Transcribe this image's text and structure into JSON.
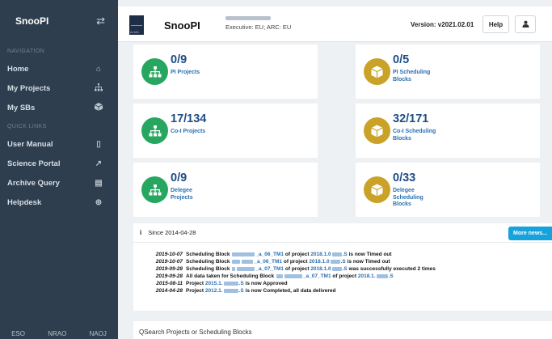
{
  "sidebar": {
    "title": "SnooPI",
    "swap_icon": "swap-icon",
    "sections": {
      "navigation": "NAVIGATION",
      "quick_links": "QUICK LINKS"
    },
    "nav_items": [
      {
        "label": "Home",
        "icon": "home-icon"
      },
      {
        "label": "My Projects",
        "icon": "sitemap-icon"
      },
      {
        "label": "My SBs",
        "icon": "cube-icon"
      }
    ],
    "quick_items": [
      {
        "label": "User Manual",
        "icon": "document-icon"
      },
      {
        "label": "Science Portal",
        "icon": "external-link-icon"
      },
      {
        "label": "Archive Query",
        "icon": "archive-icon"
      },
      {
        "label": "Helpdesk",
        "icon": "lifebuoy-icon"
      }
    ],
    "footer": [
      "ESO",
      "NRAO",
      "NAOJ"
    ]
  },
  "header": {
    "logo_text": "ALMA",
    "title": "SnooPI",
    "executive": "Executive: EU; ARC: EU",
    "version": "Version: v2021.02.01",
    "help_label": "Help",
    "user_icon": "user-icon"
  },
  "cards": [
    {
      "count": "0/9",
      "label": "PI Projects",
      "icon": "sitemap-icon",
      "color": "#27a65f"
    },
    {
      "count": "0/5",
      "label": "PI Scheduling Blocks",
      "icon": "cube-icon",
      "color": "#c9a227"
    },
    {
      "count": "17/134",
      "label": "Co-I Projects",
      "icon": "sitemap-icon",
      "color": "#27a65f"
    },
    {
      "count": "32/171",
      "label": "Co-I Scheduling Blocks",
      "icon": "cube-icon",
      "color": "#c9a227"
    },
    {
      "count": "0/9",
      "label": "Delegee Projects",
      "icon": "sitemap-icon",
      "color": "#27a65f"
    },
    {
      "count": "0/33",
      "label": "Delegee Scheduling Blocks",
      "icon": "cube-icon",
      "color": "#c9a227"
    }
  ],
  "news": {
    "since": "Since 2014-04-28",
    "more_label": "More news...",
    "rows": [
      {
        "date": "2019-10-07",
        "t1": "Scheduling Block",
        "sb": "_a_06_TM1",
        "t2": "of project",
        "proj": "2018.1.0",
        "proj_end": ".S",
        "t3": "is now Timed out"
      },
      {
        "date": "2019-10-07",
        "t1": "Scheduling Block",
        "sb": "_a_06_TM1",
        "t2": "of project",
        "proj": "2018.1.0",
        "proj_end": ".S",
        "t3": "is now Timed out"
      },
      {
        "date": "2019-09-28",
        "t1": "Scheduling Block",
        "sb": "_a_07_TM1",
        "t2": "of project",
        "proj": "2018.1.0",
        "proj_end": ".S",
        "t3": "was successfully executed 2 times"
      },
      {
        "date": "2019-09-28",
        "t1": "All data taken for Scheduling Block",
        "sb": "_a_07_TM1",
        "t2": "of project",
        "proj": "2018.1.",
        "proj_end": ".S",
        "t3": ""
      },
      {
        "date": "2015-08-11",
        "t1": "Project",
        "sb": "",
        "t2": "",
        "proj": "2015.1.",
        "proj_end": ".S",
        "t3": "is now Approved"
      },
      {
        "date": "2014-04-28",
        "t1": "Project",
        "sb": "",
        "t2": "",
        "proj": "2012.1.",
        "proj_end": ".S",
        "t3": "is now Completed, all data delivered"
      }
    ]
  },
  "search": {
    "placeholder": "QSearch Projects or Scheduling Blocks"
  }
}
